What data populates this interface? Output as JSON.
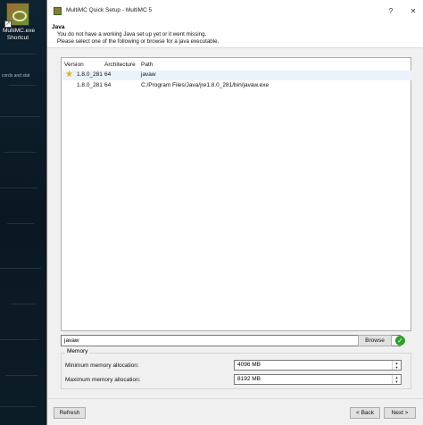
{
  "desktop": {
    "shortcut": {
      "name": "MultiMC.exe",
      "label2": "Shortcut"
    },
    "fragment_text": "cords and stat"
  },
  "window": {
    "title": "MultiMC Quick Setup - MultiMC 5",
    "help_glyph": "?",
    "close_glyph": "✕"
  },
  "header": {
    "title": "Java",
    "line1": "You do not have a working Java set up yet or it went missing.",
    "line2": "Please select one of the following or browse for a java executable."
  },
  "java_list": {
    "columns": [
      "Version",
      "Architecture",
      "Path"
    ],
    "rows": [
      {
        "version": "1.8.0_281",
        "architecture": "64",
        "path": "javaw",
        "recommended": true
      },
      {
        "version": "1.8.0_281",
        "architecture": "64",
        "path": "C:/Program Files/Java/jre1.8.0_281/bin/javaw.exe",
        "recommended": false
      }
    ]
  },
  "path_field": {
    "value": "javaw",
    "browse_label": "Browse",
    "status": "✓"
  },
  "memory": {
    "title": "Memory",
    "min_label": "Minimum memory allocation:",
    "min_value": "4096 MB",
    "max_label": "Maximum memory allocation:",
    "max_value": "8192 MB"
  },
  "footer": {
    "refresh_label": "Refresh",
    "back_label": "< Back",
    "next_label": "Next >"
  },
  "colors": {
    "accent_ok": "#2ca02c",
    "selection": "#eaf3fb"
  }
}
